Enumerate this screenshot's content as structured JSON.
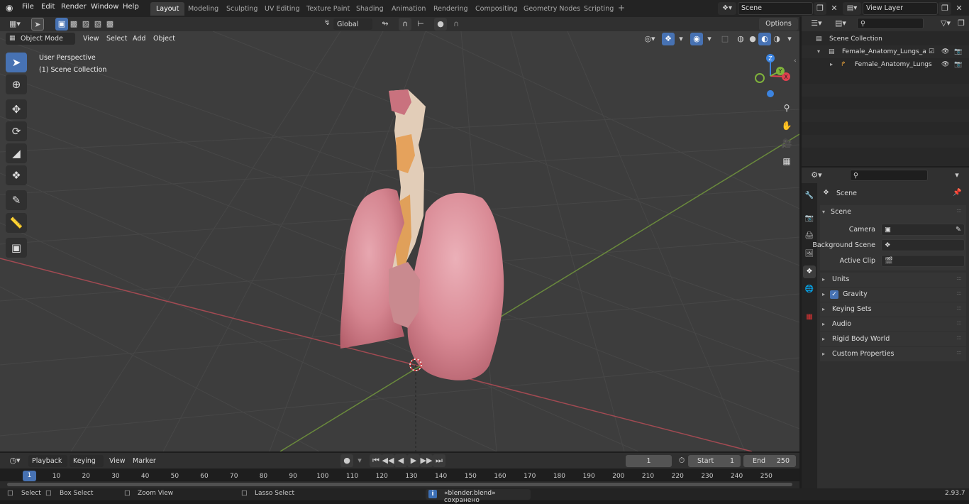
{
  "topbar": {
    "menu": [
      "File",
      "Edit",
      "Render",
      "Window",
      "Help"
    ],
    "workspaces": [
      "Layout",
      "Modeling",
      "Sculpting",
      "UV Editing",
      "Texture Paint",
      "Shading",
      "Animation",
      "Rendering",
      "Compositing",
      "Geometry Nodes",
      "Scripting"
    ],
    "active_workspace": "Layout",
    "add_tab": "+",
    "scene_name": "Scene",
    "view_layer": "View Layer"
  },
  "tool_header": {
    "orientation": "Global",
    "options": "Options"
  },
  "viewport_header": {
    "mode": "Object Mode",
    "menus": [
      "View",
      "Select",
      "Add",
      "Object"
    ]
  },
  "viewport": {
    "perspective": "User Perspective",
    "collection": "(1) Scene Collection",
    "gizmo_axes": [
      "Z",
      "Y",
      "X"
    ]
  },
  "outliner": {
    "root": "Scene Collection",
    "collection": "Female_Anatomy_Lungs_anc",
    "object": "Female_Anatomy_Lungs"
  },
  "properties": {
    "context": "Scene",
    "panel": "Scene",
    "camera_label": "Camera",
    "background_label": "Background Scene",
    "clip_label": "Active Clip",
    "subpanels": [
      "Units",
      "Gravity",
      "Keying Sets",
      "Audio",
      "Rigid Body World",
      "Custom Properties"
    ],
    "gravity_checked": true
  },
  "timeline": {
    "menus": [
      "Playback",
      "Keying",
      "View",
      "Marker"
    ],
    "current_frame": "1",
    "start_label": "Start",
    "start_value": "1",
    "end_label": "End",
    "end_value": "250",
    "ruler_current": "1",
    "ruler": [
      "10",
      "20",
      "30",
      "40",
      "50",
      "60",
      "70",
      "80",
      "90",
      "100",
      "110",
      "120",
      "130",
      "140",
      "150",
      "160",
      "170",
      "180",
      "190",
      "200",
      "210",
      "220",
      "230",
      "240",
      "250"
    ]
  },
  "statusbar": {
    "select": "Select",
    "box_select": "Box Select",
    "zoom_view": "Zoom View",
    "lasso_select": "Lasso Select",
    "message": "«blender.blend» сохранено",
    "version": "2.93.7"
  },
  "colors": {
    "accent": "#4772b3",
    "x_axis": "#e0414f",
    "y_axis": "#7fb23b",
    "z_axis": "#3c84e0",
    "lung": "#d98a95"
  }
}
